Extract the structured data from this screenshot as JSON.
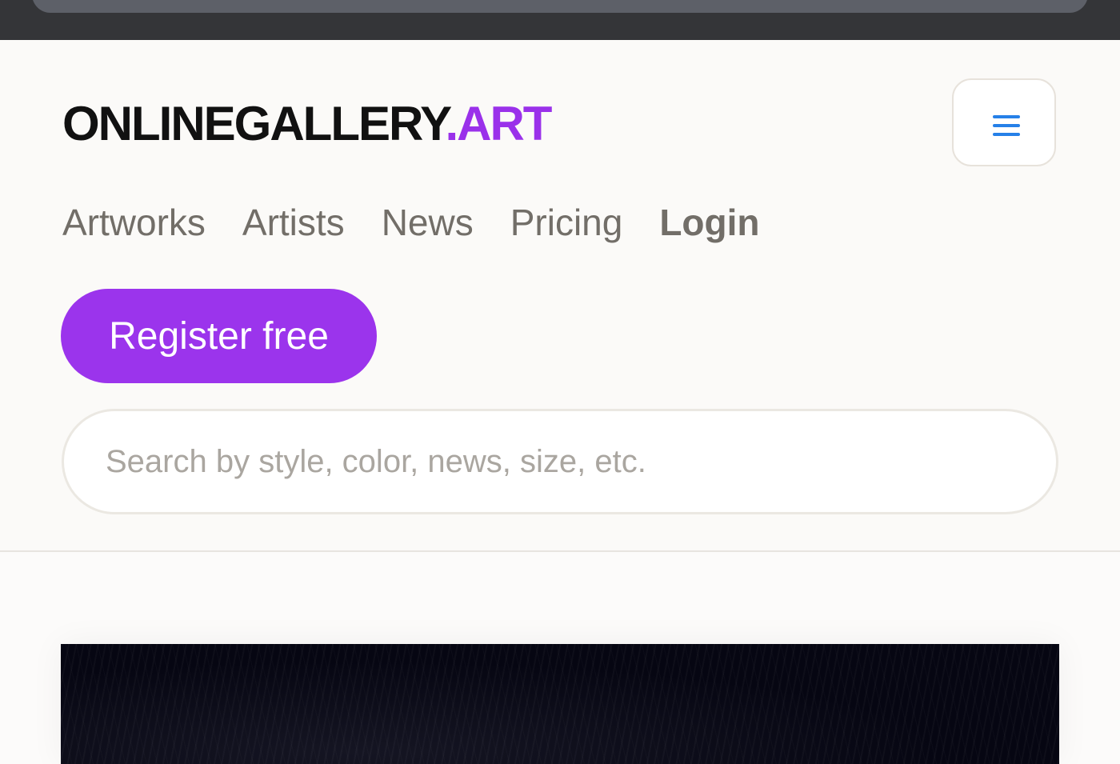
{
  "logo": {
    "main": "ONLINEGALLERY",
    "tld": ".ART",
    "brand_color": "#9a31ea"
  },
  "menu_button": {
    "icon": "hamburger-menu-icon",
    "icon_color": "#2680e8"
  },
  "nav": {
    "items": [
      {
        "label": "Artworks"
      },
      {
        "label": "Artists"
      },
      {
        "label": "News"
      },
      {
        "label": "Pricing"
      },
      {
        "label": "Login"
      }
    ]
  },
  "register": {
    "label": "Register free",
    "color": "#9b34ec"
  },
  "search": {
    "placeholder": "Search by style, color, news, size, etc.",
    "value": ""
  }
}
